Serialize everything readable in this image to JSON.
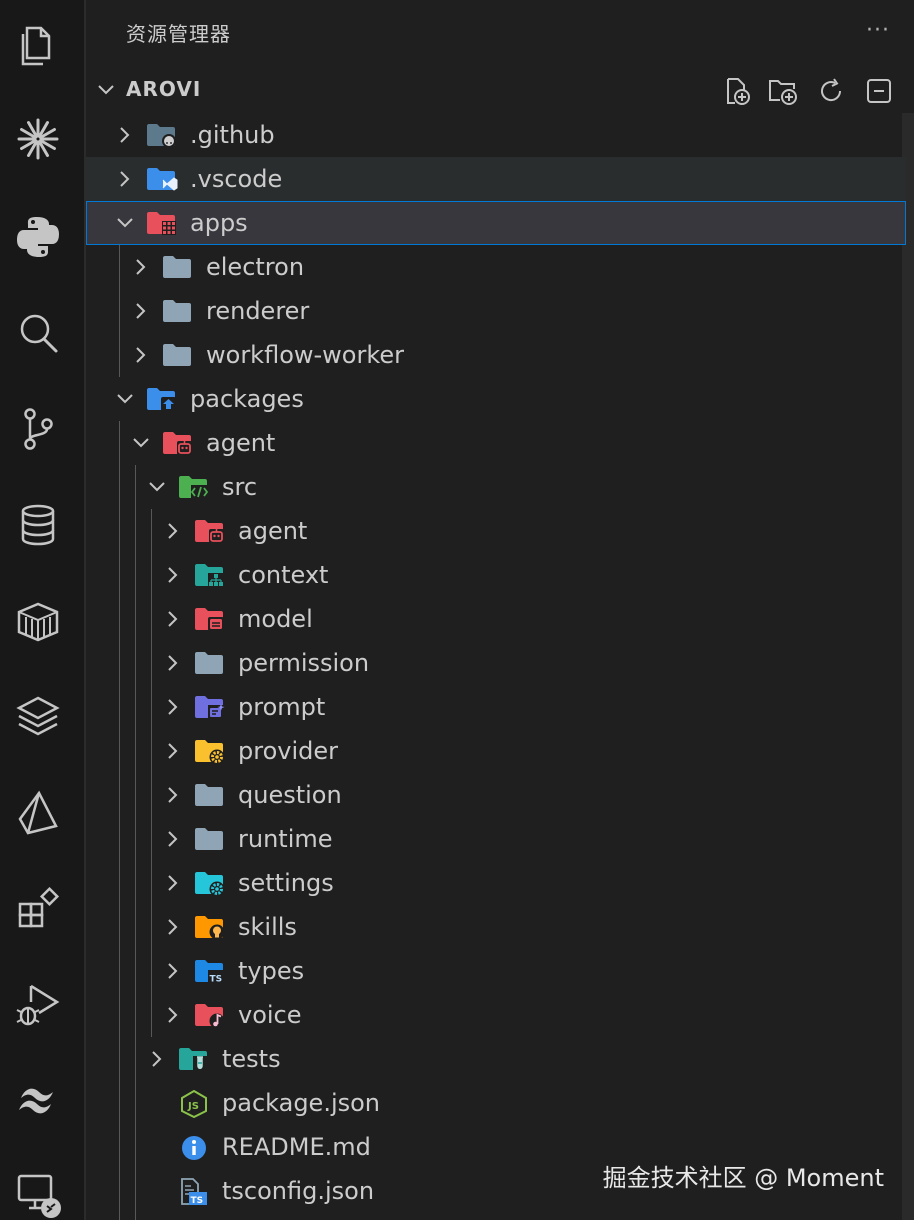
{
  "activity_bar": [
    {
      "name": "explorer-icon"
    },
    {
      "name": "spark-icon"
    },
    {
      "name": "python-icon"
    },
    {
      "name": "search-icon"
    },
    {
      "name": "source-control-icon"
    },
    {
      "name": "database-icon"
    },
    {
      "name": "container-icon"
    },
    {
      "name": "layers-icon"
    },
    {
      "name": "prism-icon"
    },
    {
      "name": "extensions-icon"
    },
    {
      "name": "run-debug-icon"
    },
    {
      "name": "tailwind-icon"
    },
    {
      "name": "remote-explorer-icon"
    }
  ],
  "sidebar": {
    "title": "资源管理器",
    "more": "···",
    "section_title": "AROVI",
    "toolbar": {
      "new_file": "new-file-icon",
      "new_folder": "new-folder-icon",
      "refresh": "refresh-icon",
      "collapse": "collapse-all-icon"
    }
  },
  "tree": [
    {
      "label": ".github",
      "depth": 0,
      "expanded": false,
      "kind": "folder",
      "icon": "github-folder",
      "color": "#5d7a8c"
    },
    {
      "label": ".vscode",
      "depth": 0,
      "expanded": false,
      "kind": "folder",
      "icon": "vscode-folder",
      "color": "#3b8eea",
      "state": "hover"
    },
    {
      "label": "apps",
      "depth": 0,
      "expanded": true,
      "kind": "folder",
      "icon": "apps-folder",
      "color": "#e8505b",
      "state": "selected"
    },
    {
      "label": "electron",
      "depth": 1,
      "expanded": false,
      "kind": "folder",
      "icon": "plain-folder",
      "color": "#8fa5b5"
    },
    {
      "label": "renderer",
      "depth": 1,
      "expanded": false,
      "kind": "folder",
      "icon": "plain-folder",
      "color": "#8fa5b5"
    },
    {
      "label": "workflow-worker",
      "depth": 1,
      "expanded": false,
      "kind": "folder",
      "icon": "plain-folder",
      "color": "#8fa5b5"
    },
    {
      "label": "packages",
      "depth": 0,
      "expanded": true,
      "kind": "folder",
      "icon": "packages-folder",
      "color": "#3b8eea"
    },
    {
      "label": "agent",
      "depth": 1,
      "expanded": true,
      "kind": "folder",
      "icon": "robot-folder",
      "color": "#e8505b"
    },
    {
      "label": "src",
      "depth": 2,
      "expanded": true,
      "kind": "folder",
      "icon": "src-folder",
      "color": "#4caf50"
    },
    {
      "label": "agent",
      "depth": 3,
      "expanded": false,
      "kind": "folder",
      "icon": "robot-folder",
      "color": "#e8505b"
    },
    {
      "label": "context",
      "depth": 3,
      "expanded": false,
      "kind": "folder",
      "icon": "tree-folder",
      "color": "#26a69a"
    },
    {
      "label": "model",
      "depth": 3,
      "expanded": false,
      "kind": "folder",
      "icon": "model-folder",
      "color": "#e8505b"
    },
    {
      "label": "permission",
      "depth": 3,
      "expanded": false,
      "kind": "folder",
      "icon": "plain-folder",
      "color": "#8fa5b5"
    },
    {
      "label": "prompt",
      "depth": 3,
      "expanded": false,
      "kind": "folder",
      "icon": "prompt-folder",
      "color": "#6f6fe0"
    },
    {
      "label": "provider",
      "depth": 3,
      "expanded": false,
      "kind": "folder",
      "icon": "gear-folder",
      "color": "#fbc02d"
    },
    {
      "label": "question",
      "depth": 3,
      "expanded": false,
      "kind": "folder",
      "icon": "plain-folder",
      "color": "#8fa5b5"
    },
    {
      "label": "runtime",
      "depth": 3,
      "expanded": false,
      "kind": "folder",
      "icon": "plain-folder",
      "color": "#8fa5b5"
    },
    {
      "label": "settings",
      "depth": 3,
      "expanded": false,
      "kind": "folder",
      "icon": "gear-folder",
      "color": "#26c6da"
    },
    {
      "label": "skills",
      "depth": 3,
      "expanded": false,
      "kind": "folder",
      "icon": "bulb-folder",
      "color": "#ff9800"
    },
    {
      "label": "types",
      "depth": 3,
      "expanded": false,
      "kind": "folder",
      "icon": "ts-folder",
      "color": "#1e88e5"
    },
    {
      "label": "voice",
      "depth": 3,
      "expanded": false,
      "kind": "folder",
      "icon": "music-folder",
      "color": "#e8505b"
    },
    {
      "label": "tests",
      "depth": 2,
      "expanded": false,
      "kind": "folder",
      "icon": "tests-folder",
      "color": "#26a69a"
    },
    {
      "label": "package.json",
      "depth": 2,
      "kind": "file",
      "icon": "nodejs-file",
      "color": "#8bc34a"
    },
    {
      "label": "README.md",
      "depth": 2,
      "kind": "file",
      "icon": "info-file",
      "color": "#3b8eea"
    },
    {
      "label": "tsconfig.json",
      "depth": 2,
      "kind": "file",
      "icon": "tsconfig-file",
      "color": "#3b8eea"
    }
  ],
  "watermark": "掘金技术社区 @ Moment"
}
